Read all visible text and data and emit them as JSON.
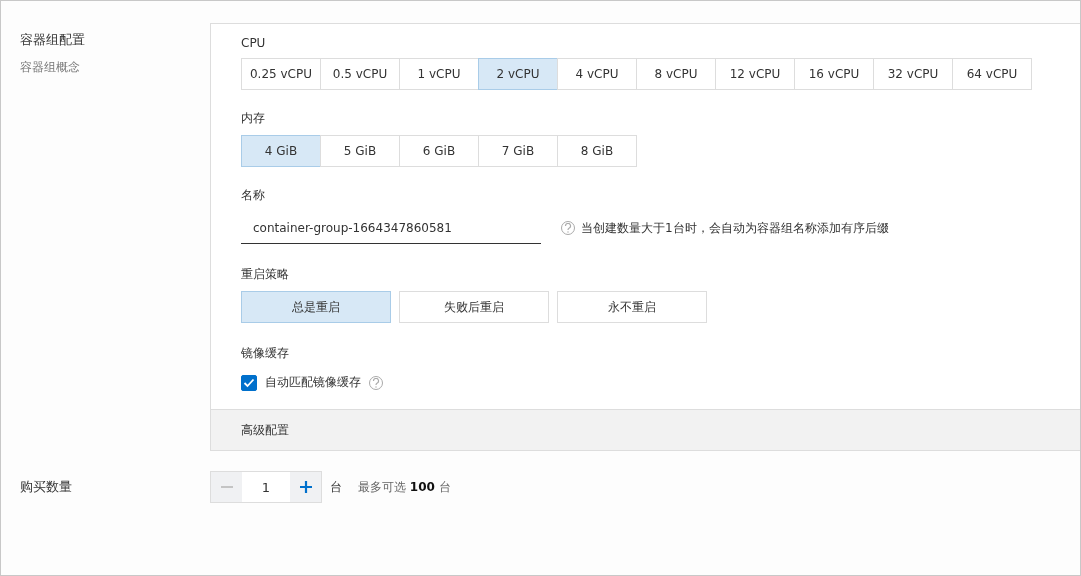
{
  "section": {
    "title": "容器组配置",
    "subtitle": "容器组概念"
  },
  "cpu": {
    "label": "CPU",
    "options": [
      {
        "label": "0.25 vCPU",
        "selected": false
      },
      {
        "label": "0.5 vCPU",
        "selected": false
      },
      {
        "label": "1 vCPU",
        "selected": false
      },
      {
        "label": "2 vCPU",
        "selected": true
      },
      {
        "label": "4 vCPU",
        "selected": false
      },
      {
        "label": "8 vCPU",
        "selected": false
      },
      {
        "label": "12 vCPU",
        "selected": false
      },
      {
        "label": "16 vCPU",
        "selected": false
      },
      {
        "label": "32 vCPU",
        "selected": false
      },
      {
        "label": "64 vCPU",
        "selected": false
      }
    ]
  },
  "memory": {
    "label": "内存",
    "options": [
      {
        "label": "4 GiB",
        "selected": true
      },
      {
        "label": "5 GiB",
        "selected": false
      },
      {
        "label": "6 GiB",
        "selected": false
      },
      {
        "label": "7 GiB",
        "selected": false
      },
      {
        "label": "8 GiB",
        "selected": false
      }
    ]
  },
  "name": {
    "label": "名称",
    "value": "container-group-1664347860581",
    "hint": "当创建数量大于1台时，会自动为容器组名称添加有序后缀"
  },
  "restart_policy": {
    "label": "重启策略",
    "options": [
      {
        "label": "总是重启",
        "selected": true
      },
      {
        "label": "失败后重启",
        "selected": false
      },
      {
        "label": "永不重启",
        "selected": false
      }
    ]
  },
  "image_cache": {
    "label": "镜像缓存",
    "checkbox": {
      "label": "自动匹配镜像缓存",
      "checked": true
    }
  },
  "advanced": {
    "label": "高级配置"
  },
  "quantity": {
    "label": "购买数量",
    "value": "1",
    "minus_disabled": true,
    "plus_disabled": false,
    "unit": "台",
    "limit": "最多可选 **100** 台"
  }
}
